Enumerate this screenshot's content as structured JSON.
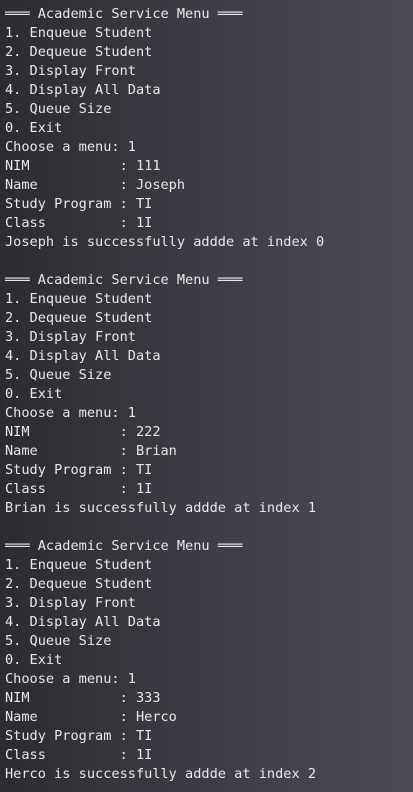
{
  "terminal": {
    "lines": [
      "═══ Academic Service Menu ═══",
      "1. Enqueue Student",
      "2. Dequeue Student",
      "3. Display Front",
      "4. Display All Data",
      "5. Queue Size",
      "0. Exit",
      "Choose a menu: 1",
      "NIM           : 111",
      "Name          : Joseph",
      "Study Program : TI",
      "Class         : 1I",
      "Joseph is successfully addde at index 0",
      "",
      "═══ Academic Service Menu ═══",
      "1. Enqueue Student",
      "2. Dequeue Student",
      "3. Display Front",
      "4. Display All Data",
      "5. Queue Size",
      "0. Exit",
      "Choose a menu: 1",
      "NIM           : 222",
      "Name          : Brian",
      "Study Program : TI",
      "Class         : 1I",
      "Brian is successfully addde at index 1",
      "",
      "═══ Academic Service Menu ═══",
      "1. Enqueue Student",
      "2. Dequeue Student",
      "3. Display Front",
      "4. Display All Data",
      "5. Queue Size",
      "0. Exit",
      "Choose a menu: 1",
      "NIM           : 333",
      "Name          : Herco",
      "Study Program : TI",
      "Class         : 1I",
      "Herco is successfully addde at index 2"
    ]
  }
}
